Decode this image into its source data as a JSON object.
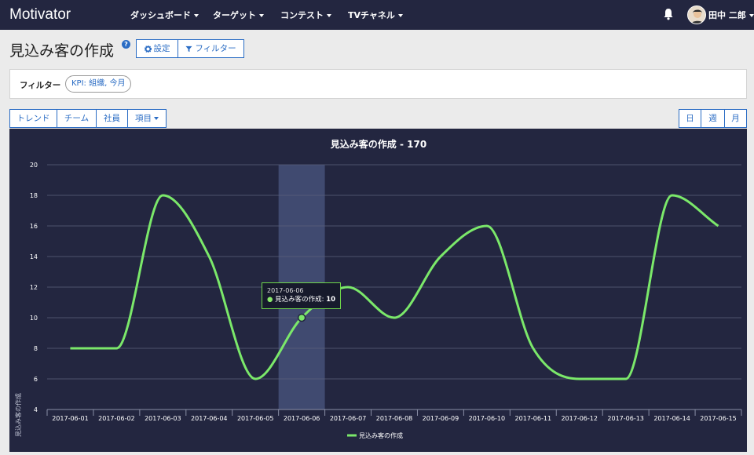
{
  "navbar": {
    "brand": "Motivator",
    "items": [
      {
        "label": "ダッシュボード"
      },
      {
        "label": "ターゲット"
      },
      {
        "label": "コンテスト"
      },
      {
        "label": "TVチャネル"
      }
    ],
    "user_name": "田中 二郎"
  },
  "page": {
    "title": "見込み客の作成",
    "help_icon": "?",
    "settings_label": "設定",
    "filter_button_label": "フィルター"
  },
  "filter": {
    "label": "フィルター",
    "chip": "KPI: 組織, 今月"
  },
  "tabs": {
    "trend": "トレンド",
    "team": "チーム",
    "staff": "社員",
    "items": "項目",
    "day": "日",
    "week": "週",
    "month": "月"
  },
  "tooltip": {
    "date": "2017-06-06",
    "series": "見込み客の作成:",
    "value": "10"
  },
  "colors": {
    "navbar": "#232640",
    "accent": "#2a6cc4",
    "chart_bg": "#232640",
    "series_line": "#7be86a"
  },
  "chart_data": {
    "type": "line",
    "title": "見込み客の作成 - 170",
    "ylabel": "見込み客の作成",
    "xlabel": "",
    "ylim": [
      4,
      20
    ],
    "yticks": [
      4,
      6,
      8,
      10,
      12,
      14,
      16,
      18,
      20
    ],
    "categories": [
      "2017-06-01",
      "2017-06-02",
      "2017-06-03",
      "2017-06-04",
      "2017-06-05",
      "2017-06-06",
      "2017-06-07",
      "2017-06-08",
      "2017-06-09",
      "2017-06-10",
      "2017-06-11",
      "2017-06-12",
      "2017-06-13",
      "2017-06-14",
      "2017-06-15"
    ],
    "series": [
      {
        "name": "見込み客の作成",
        "values": [
          8,
          8,
          18,
          14,
          6,
          10,
          12,
          10,
          14,
          16,
          8,
          6,
          6,
          18,
          16
        ]
      }
    ],
    "highlighted_category": "2017-06-06",
    "grid": true,
    "legend": "bottom-center"
  }
}
